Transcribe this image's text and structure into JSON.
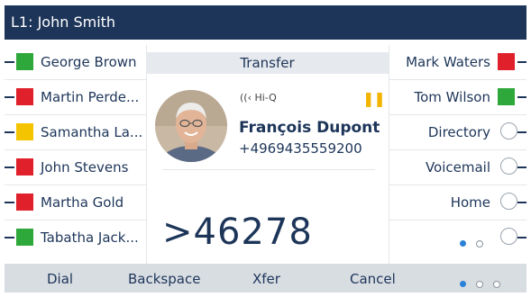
{
  "title": "L1: John Smith",
  "left_keys": [
    {
      "label": "George Brown",
      "color": "#2fa83b"
    },
    {
      "label": "Martin Perde...",
      "color": "#e0202a"
    },
    {
      "label": "Samantha La...",
      "color": "#f5c400"
    },
    {
      "label": "John Stevens",
      "color": "#e0202a"
    },
    {
      "label": "Martha Gold",
      "color": "#e0202a"
    },
    {
      "label": "Tabatha Jack...",
      "color": "#2fa83b"
    }
  ],
  "right_keys": [
    {
      "label": "Mark Waters",
      "color": "#e0202a"
    },
    {
      "label": "Tom Wilson",
      "color": "#2fa83b"
    },
    {
      "label": "Directory"
    },
    {
      "label": "Voicemail"
    },
    {
      "label": "Home"
    }
  ],
  "right_page_indicator": {
    "current": 1,
    "total": 2
  },
  "call": {
    "header": "Transfer",
    "audio_badge": "Hi-Q",
    "status_icon": "pause-icon",
    "status_color": "#f3b400",
    "name": "François Dupont",
    "number": "+4969435559200",
    "dialed": ">46278"
  },
  "softkeys": [
    "Dial",
    "Backspace",
    "Xfer",
    "Cancel"
  ],
  "softkey_page_indicator": {
    "current": 1,
    "total": 3
  }
}
